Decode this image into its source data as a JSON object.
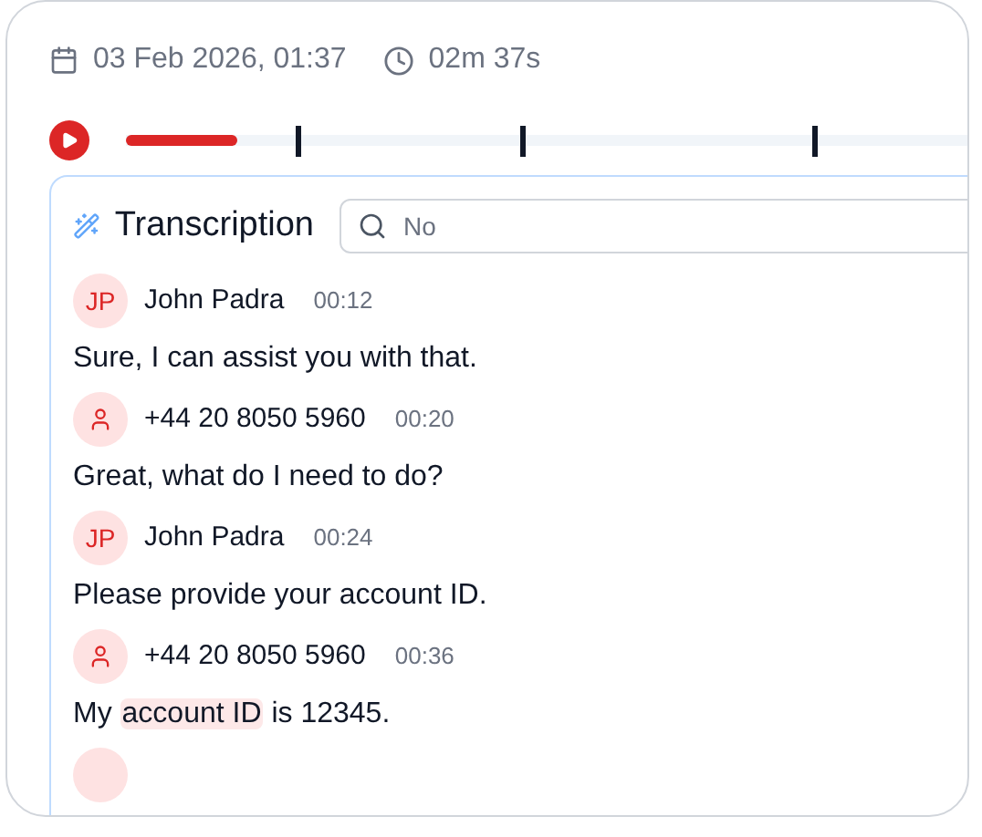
{
  "meta": {
    "date": "03 Feb 2026, 01:37",
    "duration": "02m 37s"
  },
  "player": {
    "playing": false,
    "level": 0.13
  },
  "transcription": {
    "title": "Transcription",
    "search": {
      "placeholder": "No"
    },
    "messages": [
      {
        "kind": "agent",
        "initials": "JP",
        "name": "John Padra",
        "time": "00:12",
        "parts": [
          {
            "text": "Sure, I can assist you with that.",
            "highlighted": false
          }
        ]
      },
      {
        "kind": "caller",
        "name": "+44 20 8050 5960",
        "time": "00:20",
        "parts": [
          {
            "text": "Great, what do I need to do?",
            "highlighted": false
          }
        ]
      },
      {
        "kind": "agent",
        "initials": "JP",
        "name": "John Padra",
        "time": "00:24",
        "parts": [
          {
            "text": "Please provide your account ID.",
            "highlighted": false
          }
        ]
      },
      {
        "kind": "caller",
        "name": "+44 20 8050 5960",
        "time": "00:36",
        "parts": [
          {
            "text": "My ",
            "highlighted": false
          },
          {
            "text": "account ID",
            "highlighted": true
          },
          {
            "text": " is 12345.",
            "highlighted": false
          }
        ]
      }
    ]
  }
}
